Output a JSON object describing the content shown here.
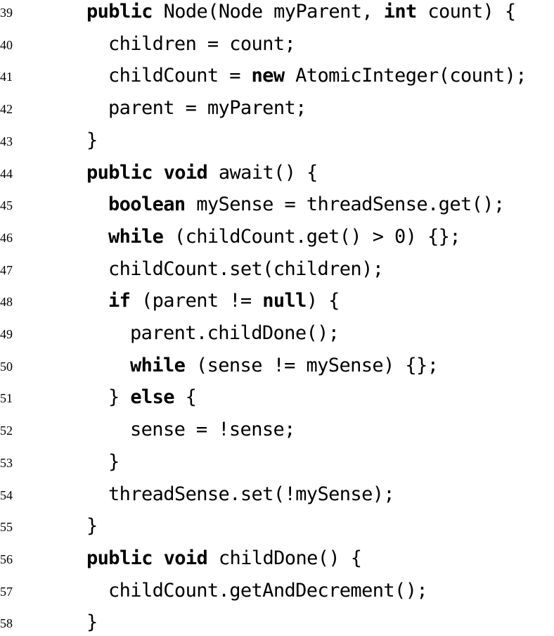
{
  "listing": {
    "lines": [
      {
        "number": "39",
        "indent": 0,
        "tokens": [
          {
            "t": "public",
            "kw": true
          },
          {
            "t": " Node(Node myParent, ",
            "kw": false
          },
          {
            "t": "int",
            "kw": true
          },
          {
            "t": " count) {",
            "kw": false
          }
        ]
      },
      {
        "number": "40",
        "indent": 1,
        "tokens": [
          {
            "t": "children = count;",
            "kw": false
          }
        ]
      },
      {
        "number": "41",
        "indent": 1,
        "tokens": [
          {
            "t": "childCount = ",
            "kw": false
          },
          {
            "t": "new",
            "kw": true
          },
          {
            "t": " AtomicInteger(count);",
            "kw": false
          }
        ]
      },
      {
        "number": "42",
        "indent": 1,
        "tokens": [
          {
            "t": "parent = myParent;",
            "kw": false
          }
        ]
      },
      {
        "number": "43",
        "indent": 0,
        "tokens": [
          {
            "t": "}",
            "kw": false
          }
        ]
      },
      {
        "number": "44",
        "indent": 0,
        "tokens": [
          {
            "t": "public",
            "kw": true
          },
          {
            "t": " ",
            "kw": false
          },
          {
            "t": "void",
            "kw": true
          },
          {
            "t": " await() {",
            "kw": false
          }
        ]
      },
      {
        "number": "45",
        "indent": 1,
        "tokens": [
          {
            "t": "boolean",
            "kw": true
          },
          {
            "t": " mySense = threadSense.get();",
            "kw": false
          }
        ]
      },
      {
        "number": "46",
        "indent": 1,
        "tokens": [
          {
            "t": "while",
            "kw": true
          },
          {
            "t": " (childCount.get() > 0) {};",
            "kw": false
          }
        ]
      },
      {
        "number": "47",
        "indent": 1,
        "tokens": [
          {
            "t": "childCount.set(children);",
            "kw": false
          }
        ]
      },
      {
        "number": "48",
        "indent": 1,
        "tokens": [
          {
            "t": "if",
            "kw": true
          },
          {
            "t": " (parent != ",
            "kw": false
          },
          {
            "t": "null",
            "kw": true
          },
          {
            "t": ") {",
            "kw": false
          }
        ]
      },
      {
        "number": "49",
        "indent": 2,
        "tokens": [
          {
            "t": "parent.childDone();",
            "kw": false
          }
        ]
      },
      {
        "number": "50",
        "indent": 2,
        "tokens": [
          {
            "t": "while",
            "kw": true
          },
          {
            "t": " (sense != mySense) {};",
            "kw": false
          }
        ]
      },
      {
        "number": "51",
        "indent": 1,
        "tokens": [
          {
            "t": "} ",
            "kw": false
          },
          {
            "t": "else",
            "kw": true
          },
          {
            "t": " {",
            "kw": false
          }
        ]
      },
      {
        "number": "52",
        "indent": 2,
        "tokens": [
          {
            "t": "sense = !sense;",
            "kw": false
          }
        ]
      },
      {
        "number": "53",
        "indent": 1,
        "tokens": [
          {
            "t": "}",
            "kw": false
          }
        ]
      },
      {
        "number": "54",
        "indent": 1,
        "tokens": [
          {
            "t": "threadSense.set(!mySense);",
            "kw": false
          }
        ]
      },
      {
        "number": "55",
        "indent": 0,
        "tokens": [
          {
            "t": "}",
            "kw": false
          }
        ]
      },
      {
        "number": "56",
        "indent": 0,
        "tokens": [
          {
            "t": "public",
            "kw": true
          },
          {
            "t": " ",
            "kw": false
          },
          {
            "t": "void",
            "kw": true
          },
          {
            "t": " childDone() {",
            "kw": false
          }
        ]
      },
      {
        "number": "57",
        "indent": 1,
        "tokens": [
          {
            "t": "childCount.getAndDecrement();",
            "kw": false
          }
        ]
      },
      {
        "number": "58",
        "indent": 0,
        "tokens": [
          {
            "t": "}",
            "kw": false
          }
        ]
      }
    ]
  }
}
